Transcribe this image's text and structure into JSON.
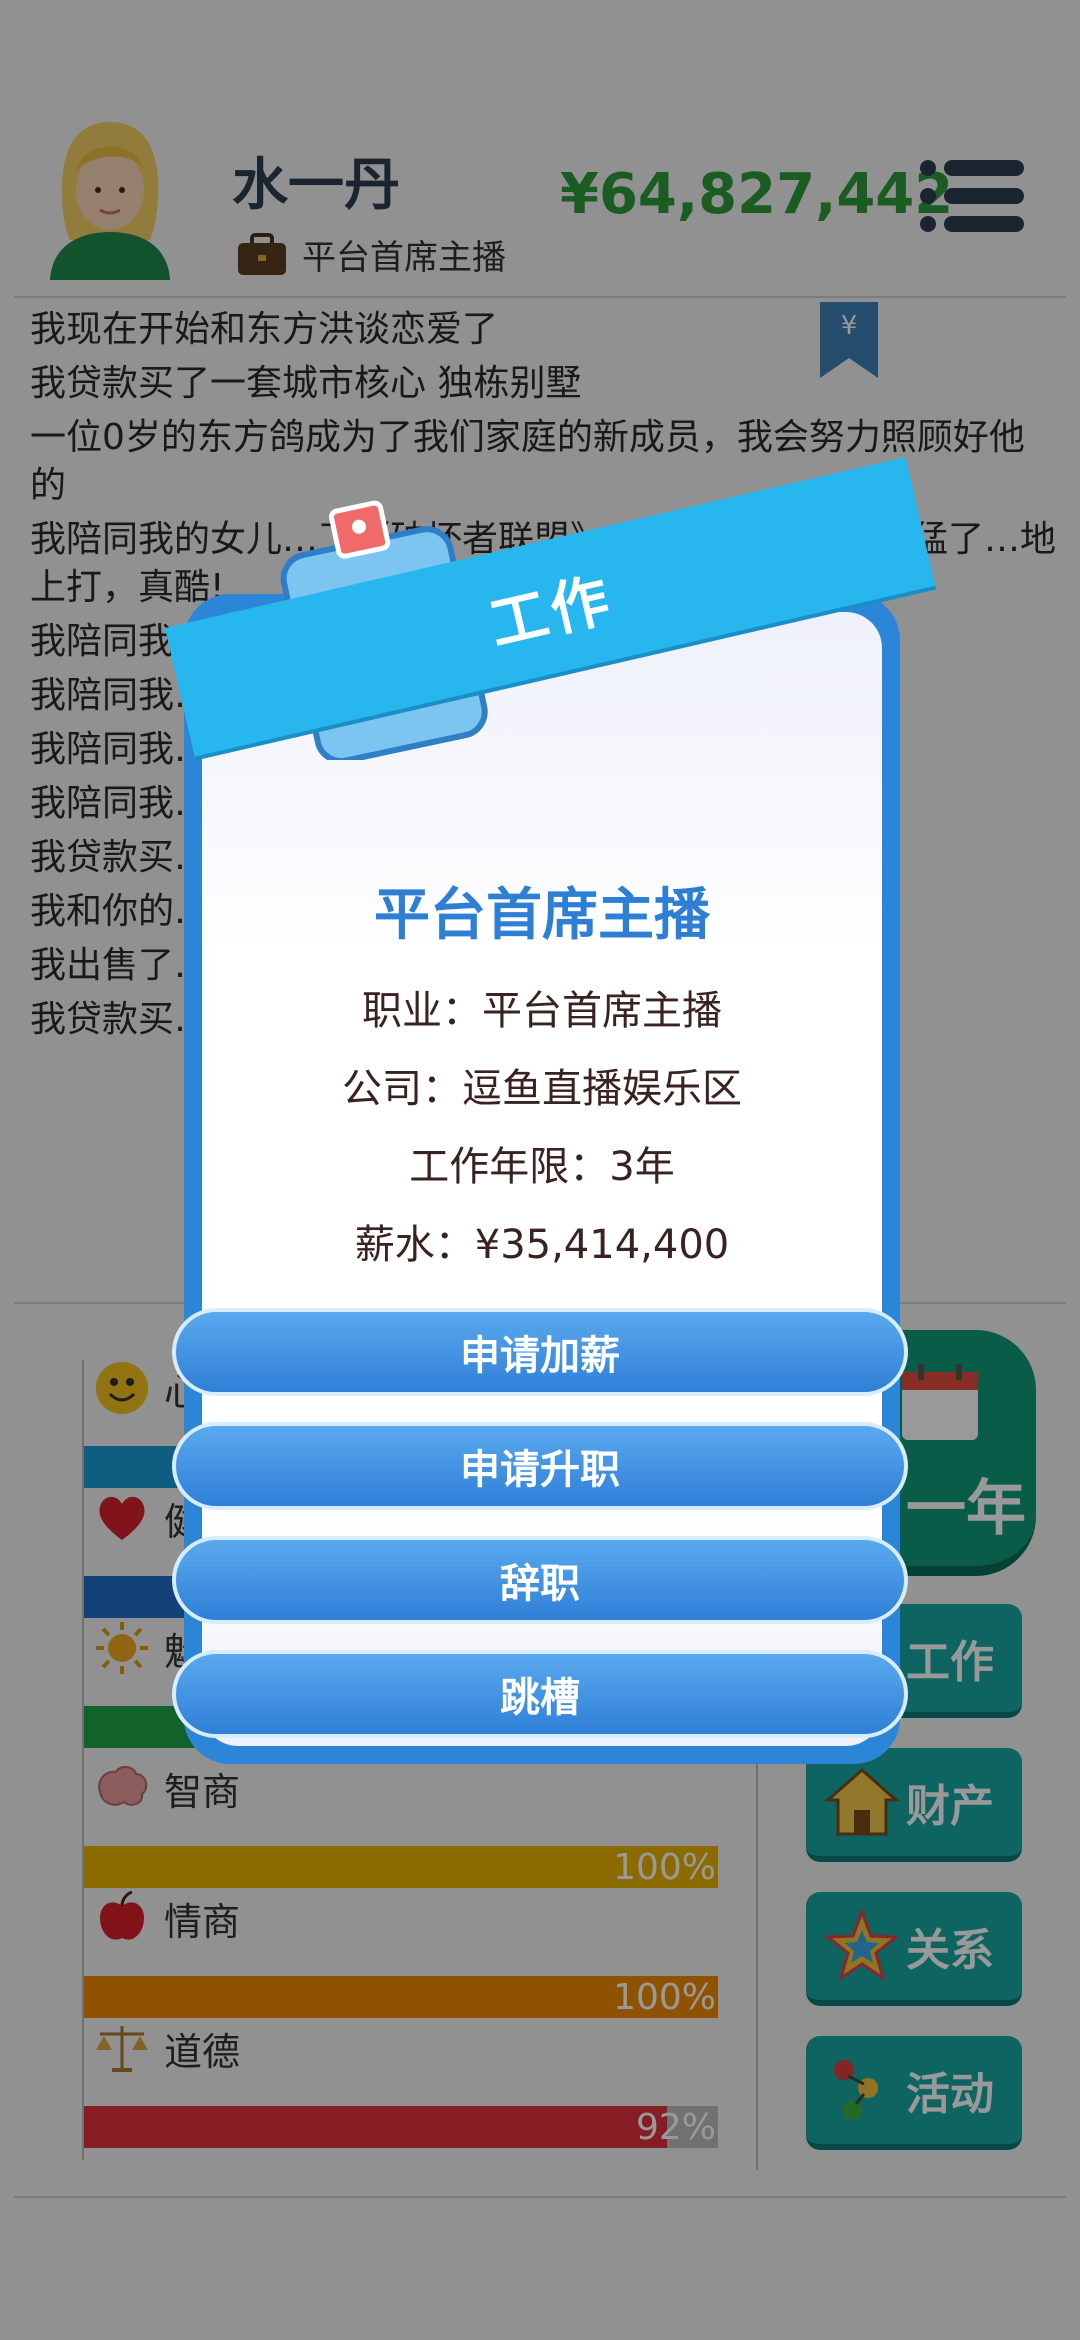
{
  "header": {
    "user_name": "水一丹",
    "job_title": "平台首席主播",
    "money": "¥64,827,442",
    "icons": {
      "avatar": "avatar",
      "job": "briefcase-icon",
      "menu": "menu-icon"
    }
  },
  "log": {
    "bookmark_icon": "yen-bookmark-icon",
    "items": [
      "我现在开始和东方洪谈恋爱了",
      "我贷款买了一套城市核心 独栋别墅",
      "一位0岁的东方鸽成为了我们家庭的新成员，我会努力照顾好他的",
      "我陪同我的女儿…了《破坏者联盟》，神兽猛霸天真的太猛了…地上打，真酷!",
      "我陪同我…苦可真有意思",
      "我陪同我…有机会来这里野…",
      "我陪同我…练习了好一会才…",
      "我陪同我…受苦可真有意思",
      "我贷款买…",
      "我和你的…",
      "我出售了…",
      "我贷款买…"
    ]
  },
  "stats": [
    {
      "label": "心…",
      "icon": "smiley-icon",
      "percent": null,
      "color": "#1a9bd7"
    },
    {
      "label": "健…",
      "icon": "heart-icon",
      "percent": null,
      "color": "#1f6fc9"
    },
    {
      "label": "魅…",
      "icon": "sun-icon",
      "percent": null,
      "color": "#1ea34a"
    },
    {
      "label": "智商",
      "icon": "brain-icon",
      "percent": 100,
      "value_text": "100%",
      "color": "#e8b200"
    },
    {
      "label": "情商",
      "icon": "apple-icon",
      "percent": 100,
      "value_text": "100%",
      "color": "#ee8a00"
    },
    {
      "label": "道德",
      "icon": "scales-icon",
      "percent": 92,
      "value_text": "92%",
      "color": "#e0303c"
    }
  ],
  "side_buttons": {
    "year": {
      "label": "一年",
      "icon": "calendar-icon"
    },
    "items": [
      {
        "label": "工作",
        "icon": "work-icon"
      },
      {
        "label": "财产",
        "icon": "house-icon"
      },
      {
        "label": "关系",
        "icon": "star-icon"
      },
      {
        "label": "活动",
        "icon": "activity-icon"
      }
    ]
  },
  "modal": {
    "ribbon_title": "工作",
    "badge_icon": "id-badge-icon",
    "title": "平台首席主播",
    "info": [
      "职业：平台首席主播",
      "公司：逗鱼直播娱乐区",
      "工作年限：3年",
      "薪水：¥35,414,400"
    ],
    "buttons": [
      "申请加薪",
      "申请升职",
      "辞职",
      "跳槽"
    ]
  },
  "colors": {
    "money": "#2e9a3a",
    "modal_frame": "#2b86d8",
    "ribbon": "#27b7ee",
    "modal_title": "#2d7fd6"
  }
}
